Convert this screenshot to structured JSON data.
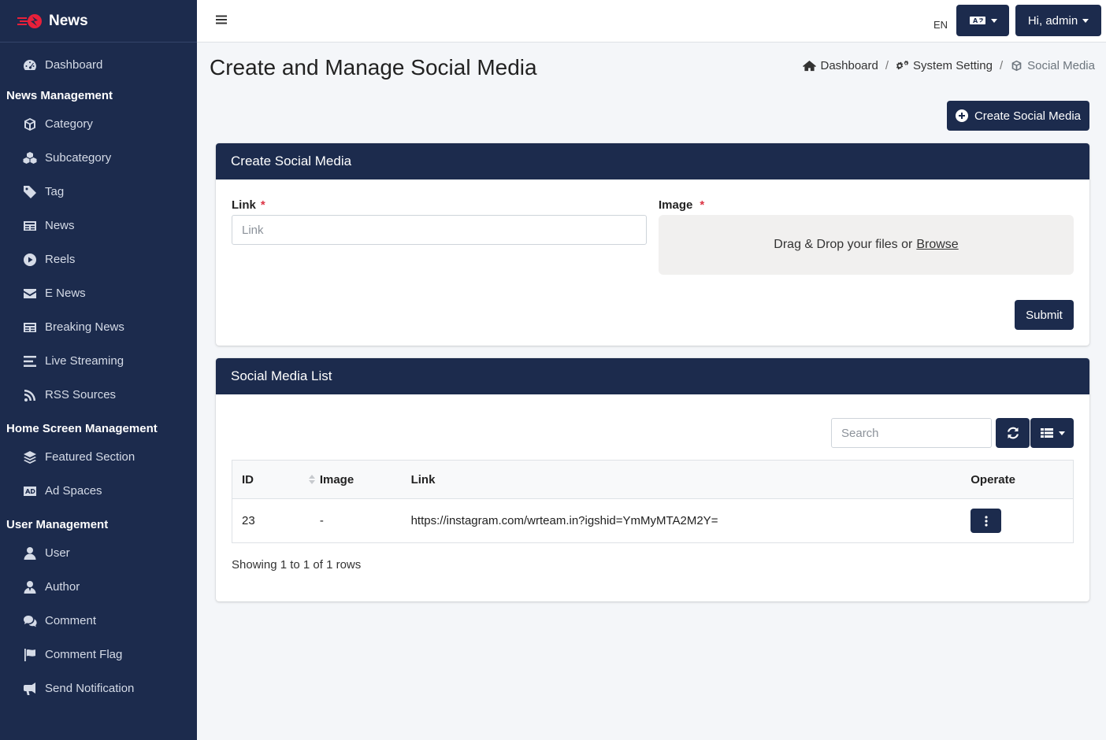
{
  "brand": {
    "name": "News"
  },
  "sidebar": {
    "top": [
      {
        "label": "Dashboard",
        "icon": "dashboard-icon"
      }
    ],
    "sections": [
      {
        "header": "News Management",
        "items": [
          {
            "label": "Category",
            "icon": "cube-icon"
          },
          {
            "label": "Subcategory",
            "icon": "cubes-icon"
          },
          {
            "label": "Tag",
            "icon": "tag-icon"
          },
          {
            "label": "News",
            "icon": "newspaper-icon"
          },
          {
            "label": "Reels",
            "icon": "play-circle-icon"
          },
          {
            "label": "E News",
            "icon": "envelope-icon"
          },
          {
            "label": "Breaking News",
            "icon": "newspaper-icon"
          },
          {
            "label": "Live Streaming",
            "icon": "bars-icon"
          },
          {
            "label": "RSS Sources",
            "icon": "rss-icon"
          }
        ]
      },
      {
        "header": "Home Screen Management",
        "items": [
          {
            "label": "Featured Section",
            "icon": "layers-icon"
          },
          {
            "label": "Ad Spaces",
            "icon": "ad-icon"
          }
        ]
      },
      {
        "header": "User Management",
        "items": [
          {
            "label": "User",
            "icon": "user-icon"
          },
          {
            "label": "Author",
            "icon": "user-tie-icon"
          },
          {
            "label": "Comment",
            "icon": "comments-icon"
          },
          {
            "label": "Comment Flag",
            "icon": "flag-icon"
          },
          {
            "label": "Send Notification",
            "icon": "bullhorn-icon"
          }
        ]
      }
    ]
  },
  "topbar": {
    "lang_code": "EN",
    "user_label": "Hi, admin"
  },
  "page": {
    "title": "Create and Manage Social Media",
    "breadcrumb": [
      "Dashboard",
      "System Setting",
      "Social Media"
    ],
    "create_button": "Create Social Media"
  },
  "form": {
    "title": "Create Social Media",
    "link_label": "Link",
    "link_placeholder": "Link",
    "image_label": "Image",
    "required_mark": "*",
    "drop_text": "Drag & Drop your files or",
    "browse_text": "Browse",
    "submit": "Submit"
  },
  "list": {
    "title": "Social Media List",
    "search_placeholder": "Search",
    "columns": [
      "ID",
      "Image",
      "Link",
      "Operate"
    ],
    "rows": [
      {
        "id": "23",
        "image": "-",
        "link": "https://instagram.com/wrteam.in?igshid=YmMyMTA2M2Y="
      }
    ],
    "footer": "Showing 1 to 1 of 1 rows"
  },
  "colors": {
    "primary": "#1c2b4d",
    "required": "#dc3545",
    "background": "#f4f6f9"
  }
}
